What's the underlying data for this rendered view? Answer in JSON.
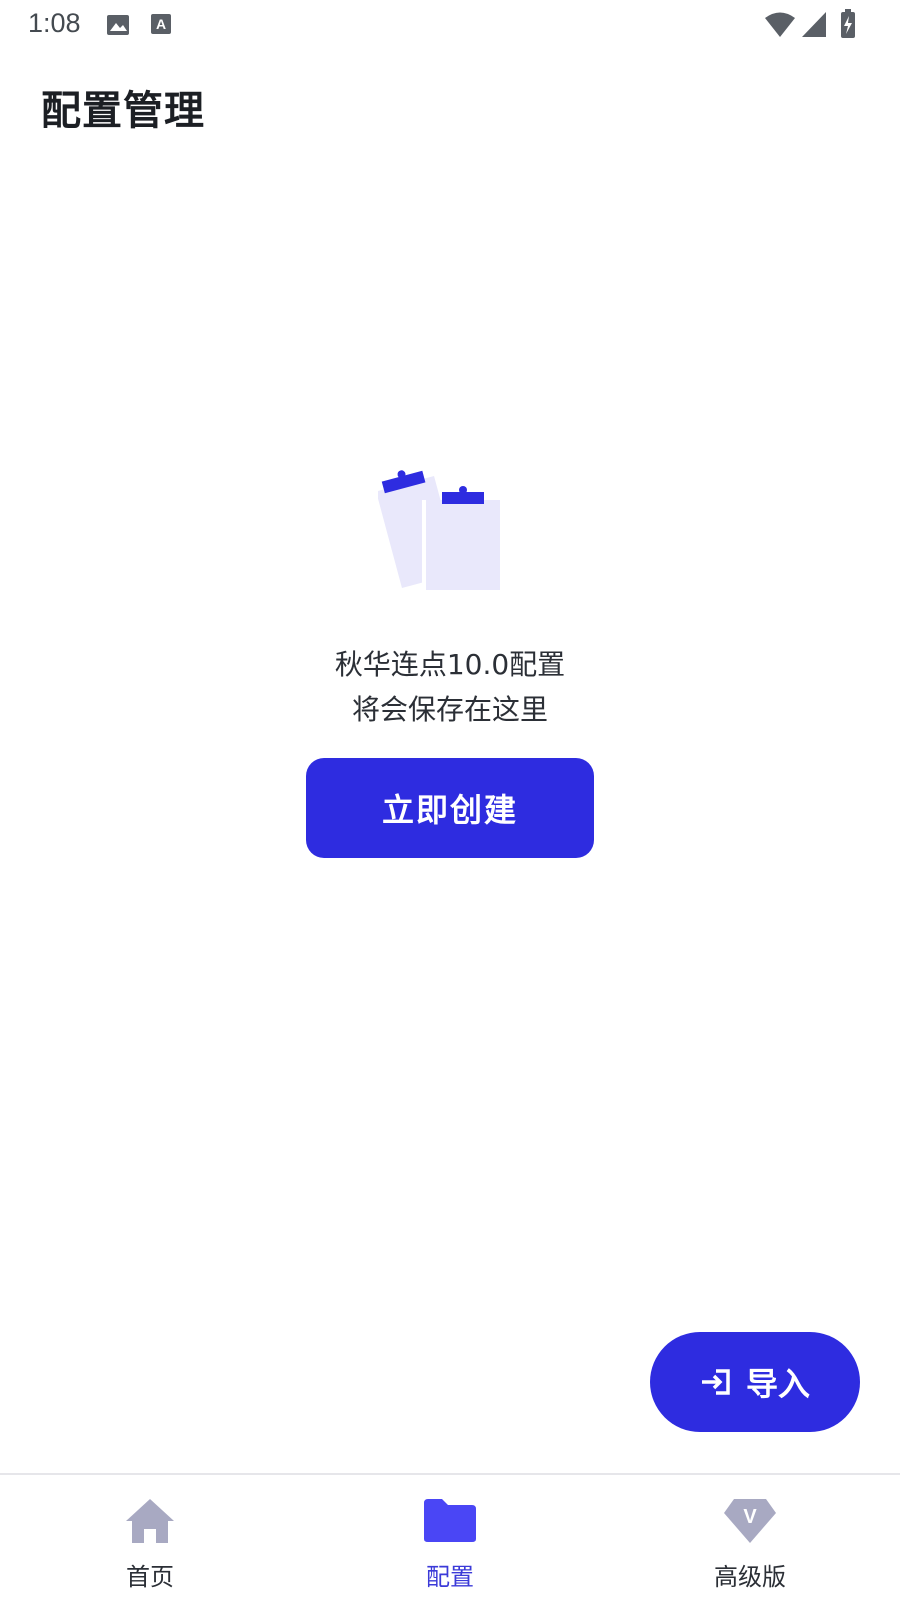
{
  "status_bar": {
    "time": "1:08"
  },
  "header": {
    "title": "配置管理"
  },
  "empty_state": {
    "line1": "秋华连点10.0配置",
    "line2": "将会保存在这里",
    "create_label": "立即创建"
  },
  "fab": {
    "import_label": "导入"
  },
  "bottom_nav": {
    "items": [
      {
        "label": "首页",
        "icon": "home-icon"
      },
      {
        "label": "配置",
        "icon": "folder-icon"
      },
      {
        "label": "高级版",
        "icon": "premium-v-icon"
      }
    ],
    "active_index": 1
  },
  "colors": {
    "accent": "#2e2ce0",
    "nav_inactive_icon": "#a8a9c2",
    "nav_active_icon": "#4a46f5",
    "illustration_paper": "#e9e8fb"
  }
}
